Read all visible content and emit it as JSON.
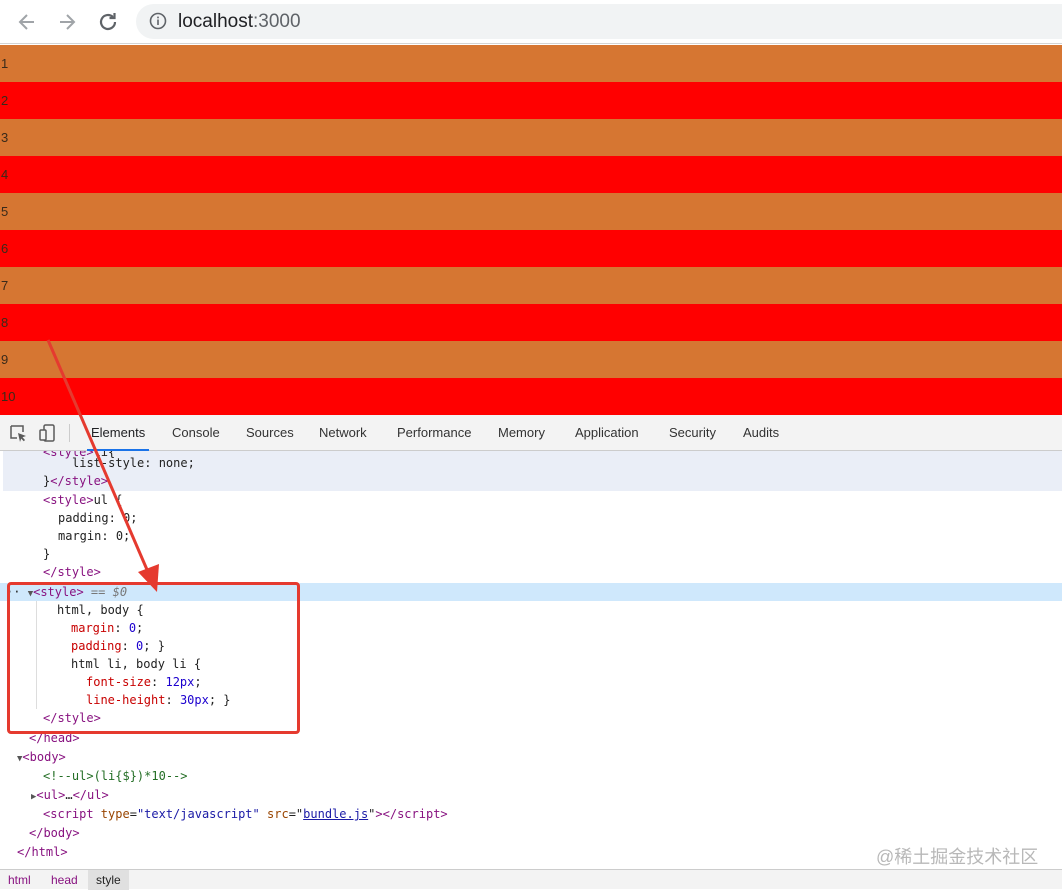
{
  "browser": {
    "url_host": "localhost",
    "url_port": ":3000"
  },
  "page": {
    "list_items": [
      "1",
      "2",
      "3",
      "4",
      "5",
      "6",
      "7",
      "8",
      "9",
      "10"
    ]
  },
  "devtools": {
    "tabs": [
      "Elements",
      "Console",
      "Sources",
      "Network",
      "Performance",
      "Memory",
      "Application",
      "Security",
      "Audits"
    ],
    "active_tab": "Elements",
    "code": {
      "style1_selector_tail": "li{",
      "style1_decl": "list-style: none;",
      "style1_close": "}",
      "style2_selector": "ul {",
      "style2_p1_name": "padding",
      "style2_p1_val": "0",
      "style2_p2_name": "margin",
      "style2_p2_val": "0",
      "brace_close": "}",
      "selected_marker": "== $0",
      "rule1_selector": "html, body {",
      "rule1_p1_name": "margin",
      "rule1_p1_val": "0",
      "rule1_p2_name": "padding",
      "rule1_p2_val": "0",
      "rule1_p2_tail": "; }",
      "rule2_selector": "html li, body li {",
      "rule2_p1_name": "font-size",
      "rule2_p1_val": "12px",
      "rule2_p2_name": "line-height",
      "rule2_p2_val": "30px",
      "rule2_p2_tail": "; }",
      "comment": "<!--ul>(li{$})*10-->",
      "ul_collapsed": "…",
      "script_type_attr": "type",
      "script_type_val": "\"text/javascript\"",
      "script_src_attr": "src",
      "script_src_val": "bundle.js"
    },
    "breadcrumbs": [
      "html",
      "head",
      "style"
    ]
  },
  "colors": {
    "row_orange": "#d67632",
    "row_red": "#ff0000",
    "annotation_red": "#e53a2f",
    "selected_row": "#cfe8fc"
  },
  "watermark": "@稀土掘金技术社区"
}
